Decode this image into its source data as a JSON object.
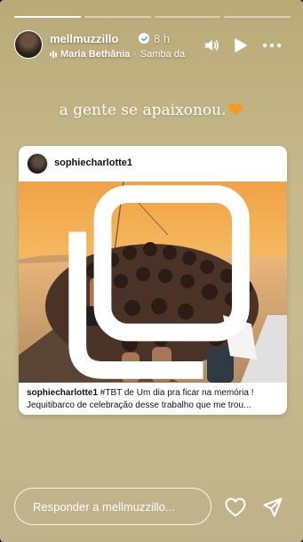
{
  "progress": {
    "segments": 4,
    "active_index": 0,
    "active_fraction": 1.0
  },
  "header": {
    "username": "mellmuzzillo",
    "time": "8 h",
    "music_artist": "Maria Bethânia",
    "music_title": "Samba da"
  },
  "caption": {
    "text": "a gente se apaixonou."
  },
  "post": {
    "username": "sophiecharlotte1",
    "caption_user": "sophiecharlotte1",
    "caption_line1": " #TBT de Um dia pra ficar na memória !",
    "caption_line2": "Jequitibarco de celebração desse trabalho que me trou..."
  },
  "reply": {
    "placeholder": "Responder a mellmuzzillo..."
  },
  "icons": {
    "verified": "verified-badge-icon",
    "music": "music-wave-icon",
    "volume": "speaker-icon",
    "play": "play-icon",
    "more": "more-horizontal-icon",
    "heart_emoji": "orange-heart-icon",
    "multi": "multiple-photos-icon",
    "like": "heart-outline-icon",
    "send": "paper-plane-icon"
  },
  "colors": {
    "background": "#c6b98b",
    "heart_emoji": "#f39a2a",
    "text": "#ffffff"
  }
}
